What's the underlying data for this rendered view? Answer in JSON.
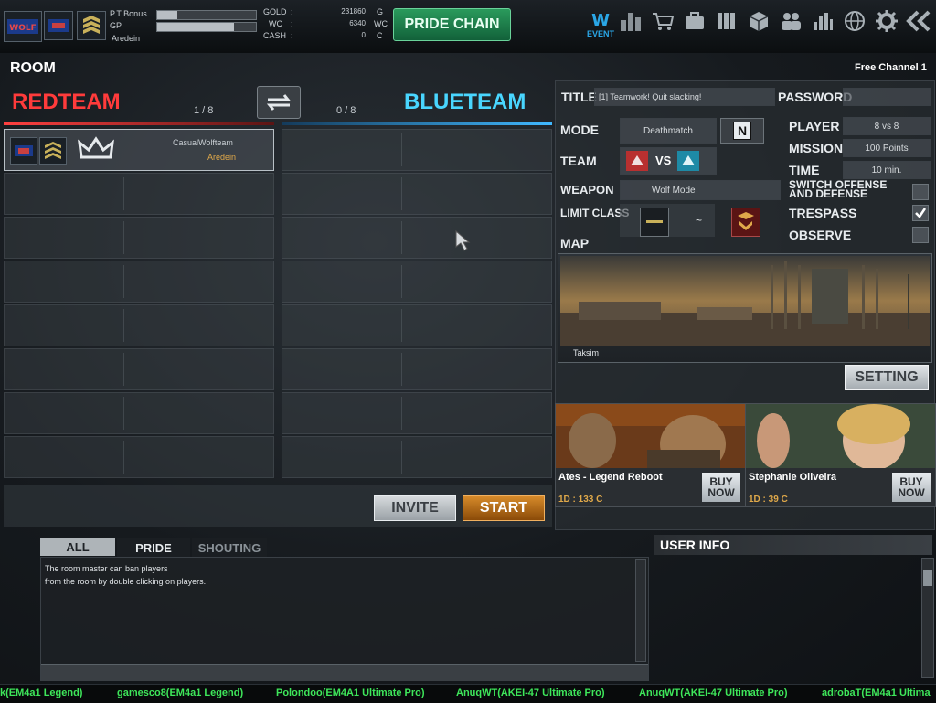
{
  "player": {
    "pt_bonus_label": "P.T Bonus",
    "gp_label": "GP",
    "name": "Aredein",
    "pt_bonus_fill": 0.2,
    "gp_fill": 0.78
  },
  "currency": {
    "gold_label": "GOLD",
    "gold_value": "231860",
    "gold_unit": "G",
    "wc_label": "WC",
    "wc_value": "6340",
    "wc_unit": "WC",
    "cash_label": "CASH",
    "cash_value": "0",
    "cash_unit": "C"
  },
  "pride_chain": "PRIDE CHAIN",
  "event_label": "EVENT",
  "room": {
    "label": "ROOM",
    "channel": "Free Channel 1"
  },
  "teams": {
    "red": "REDTEAM",
    "red_count": "1 / 8",
    "blue": "BLUETEAM",
    "blue_count": "0 / 8"
  },
  "red_slots": [
    {
      "clan": "CasualWolfteam",
      "name": "Aredein"
    }
  ],
  "settings": {
    "title_label": "TITLE",
    "title_value": "[1] Teamwork! Quit slacking!",
    "password_label": "PASSWORD",
    "mode_label": "MODE",
    "mode_value": "Deathmatch",
    "team_label": "TEAM",
    "vs": "VS",
    "weapon_label": "WEAPON",
    "weapon_value": "Wolf Mode",
    "limit_label": "LIMIT CLASS",
    "tilde": "~",
    "map_label": "MAP",
    "map_name": "Taksim",
    "n_badge": "N",
    "player_label": "PLAYER",
    "player_value": "8 vs 8",
    "mission_label": "MISSION",
    "mission_value": "100 Points",
    "time_label": "TIME",
    "time_value": "10 min.",
    "switch_label": "SWITCH OFFENSE AND DEFENSE",
    "trespass_label": "TRESPASS",
    "observe_label": "OBSERVE",
    "setting_btn": "SETTING",
    "trespass_checked": true
  },
  "shop": [
    {
      "name": "Ates - Legend Reboot",
      "price": "1D : 133 C",
      "buy": "BUY NOW"
    },
    {
      "name": "Stephanie Oliveira",
      "price": "1D : 39 C",
      "buy": "BUY NOW"
    }
  ],
  "buttons": {
    "invite": "INVITE",
    "start": "START"
  },
  "chat": {
    "tabs": [
      "ALL",
      "PRIDE",
      "SHOUTING"
    ],
    "line1": "The room master can ban players",
    "line2": "from the room by double clicking on players."
  },
  "user_info": "USER INFO",
  "ticker": [
    "k(EM4a1 Legend)",
    "gamesco8(EM4a1 Legend)",
    "Polondoo(EM4A1 Ultimate Pro)",
    "AnuqWT(AKEI-47 Ultimate Pro)",
    "AnuqWT(AKEI-47 Ultimate Pro)",
    "adrobaT(EM4a1 Ultima"
  ]
}
